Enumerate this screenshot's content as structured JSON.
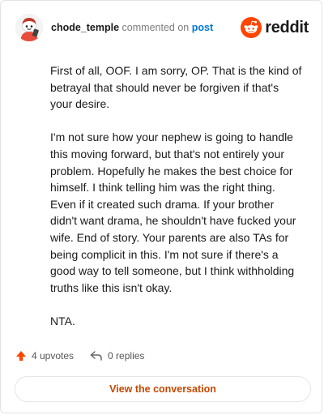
{
  "header": {
    "username": "chode_temple",
    "action_text": "commented on",
    "post_link": "post",
    "brand": "reddit"
  },
  "comment": {
    "paragraphs": [
      "First of all, OOF. I am sorry, OP. That is the kind of betrayal that should never be forgiven if that's your desire.",
      "I'm not sure how your nephew is going to handle this moving forward, but that's not entirely your problem. Hopefully he makes the best choice for himself. I think telling him was the right thing. Even if it created such drama. If your brother didn't want drama, he shouldn't have fucked your wife. End of story. Your parents are also TAs for being complicit in this. I'm not sure if there's a good way to tell someone, but I think withholding truths like this isn't okay.",
      "NTA."
    ]
  },
  "footer": {
    "upvotes": "4 upvotes",
    "replies": "0 replies",
    "view_button": "View the conversation"
  },
  "colors": {
    "upvote": "#ff4500",
    "link": "#0079d3",
    "button_text": "#c44800",
    "brand_orange": "#ff4500"
  },
  "icons": {
    "avatar": "snoo-avatar",
    "brand": "reddit-logo-icon",
    "upvote": "upvote-arrow-icon",
    "reply": "reply-arrow-icon"
  }
}
